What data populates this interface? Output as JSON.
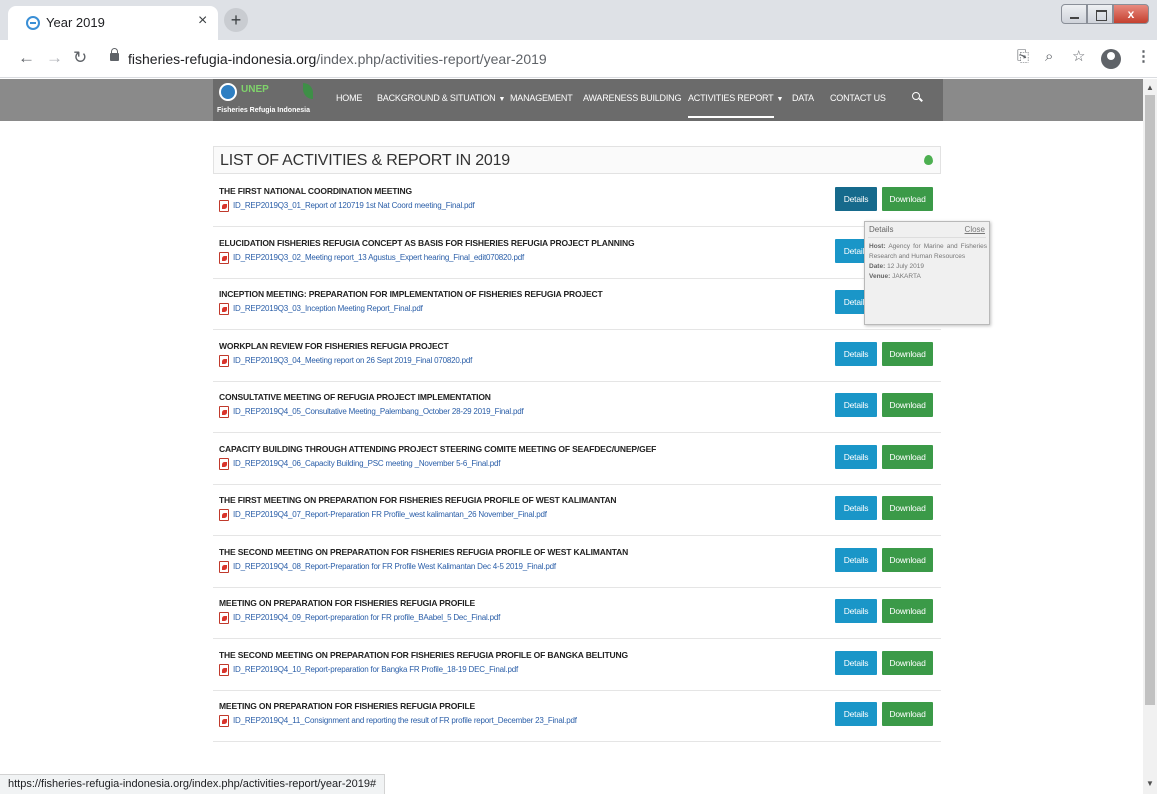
{
  "browser": {
    "tab_title": "Year 2019",
    "tab_close": "×",
    "new_tab": "+",
    "url_host": "fisheries-refugia-indonesia.org",
    "url_path": "/index.php/activities-report/year-2019",
    "status_url": "https://fisheries-refugia-indonesia.org/index.php/activities-report/year-2019#",
    "window_close": "x"
  },
  "site": {
    "logo_text": "Fisheries Refugia Indonesia",
    "logo_word": "UNEP",
    "menu": [
      {
        "label": "HOME",
        "has_caret": false,
        "active": false
      },
      {
        "label": "BACKGROUND & SITUATION",
        "has_caret": true,
        "active": false
      },
      {
        "label": "MANAGEMENT",
        "has_caret": false,
        "active": false
      },
      {
        "label": "AWARENESS BUILDING",
        "has_caret": false,
        "active": false
      },
      {
        "label": "ACTIVITIES REPORT",
        "has_caret": true,
        "active": true
      },
      {
        "label": "DATA",
        "has_caret": false,
        "active": false
      },
      {
        "label": "CONTACT US",
        "has_caret": false,
        "active": false
      }
    ]
  },
  "panel": {
    "title": "LIST OF ACTIVITIES & REPORT IN 2019",
    "details_label": "Details",
    "download_label": "Download",
    "items": [
      {
        "title": "THE FIRST NATIONAL COORDINATION MEETING",
        "file": "ID_REP2019Q3_01_Report of 120719 1st Nat Coord meeting_Final.pdf"
      },
      {
        "title": "ELUCIDATION FISHERIES REFUGIA CONCEPT AS BASIS FOR FISHERIES REFUGIA PROJECT PLANNING",
        "file": "ID_REP2019Q3_02_Meeting report_13 Agustus_Expert hearing_Final_edit070820.pdf"
      },
      {
        "title": "INCEPTION MEETING: PREPARATION FOR IMPLEMENTATION OF FISHERIES REFUGIA PROJECT",
        "file": "ID_REP2019Q3_03_Inception Meeting Report_Final.pdf"
      },
      {
        "title": "WORKPLAN REVIEW FOR FISHERIES REFUGIA PROJECT",
        "file": "ID_REP2019Q3_04_Meeting report on 26 Sept 2019_Final 070820.pdf"
      },
      {
        "title": "CONSULTATIVE MEETING OF REFUGIA PROJECT IMPLEMENTATION",
        "file": "ID_REP2019Q4_05_Consultative Meeting_Palembang_October 28-29 2019_Final.pdf"
      },
      {
        "title": "CAPACITY BUILDING THROUGH ATTENDING PROJECT STEERING COMITE MEETING OF SEAFDEC/UNEP/GEF",
        "file": "ID_REP2019Q4_06_Capacity Building_PSC meeting _November 5-6_Final.pdf"
      },
      {
        "title": "THE FIRST MEETING ON PREPARATION FOR FISHERIES REFUGIA PROFILE OF WEST KALIMANTAN",
        "file": "ID_REP2019Q4_07_Report-Preparation FR Profile_west kalimantan_26 November_Final.pdf"
      },
      {
        "title": "THE SECOND MEETING ON PREPARATION FOR FISHERIES REFUGIA PROFILE OF WEST KALIMANTAN",
        "file": "ID_REP2019Q4_08_Report-Preparation for FR Profile West Kalimantan Dec 4-5 2019_Final.pdf"
      },
      {
        "title": "MEETING ON PREPARATION FOR FISHERIES REFUGIA PROFILE",
        "file": "ID_REP2019Q4_09_Report-preparation for FR profile_BAabel_5 Dec_Final.pdf"
      },
      {
        "title": "THE SECOND MEETING ON PREPARATION FOR FISHERIES REFUGIA PROFILE OF BANGKA BELITUNG",
        "file": "ID_REP2019Q4_10_Report-preparation for Bangka FR Profile_18-19 DEC_Final.pdf"
      },
      {
        "title": "MEETING ON PREPARATION FOR FISHERIES REFUGIA PROFILE",
        "file": "ID_REP2019Q4_11_Consignment and reporting the result of FR profile report_December 23_Final.pdf"
      }
    ]
  },
  "popover": {
    "title": "Details",
    "close": "Close",
    "host_label": "Host:",
    "host_value": "Agency for Marine and Fisheries Research and Human Resources",
    "date_label": "Date:",
    "date_value": "12 July 2019",
    "venue_label": "Venue:",
    "venue_value": "JAKARTA"
  }
}
